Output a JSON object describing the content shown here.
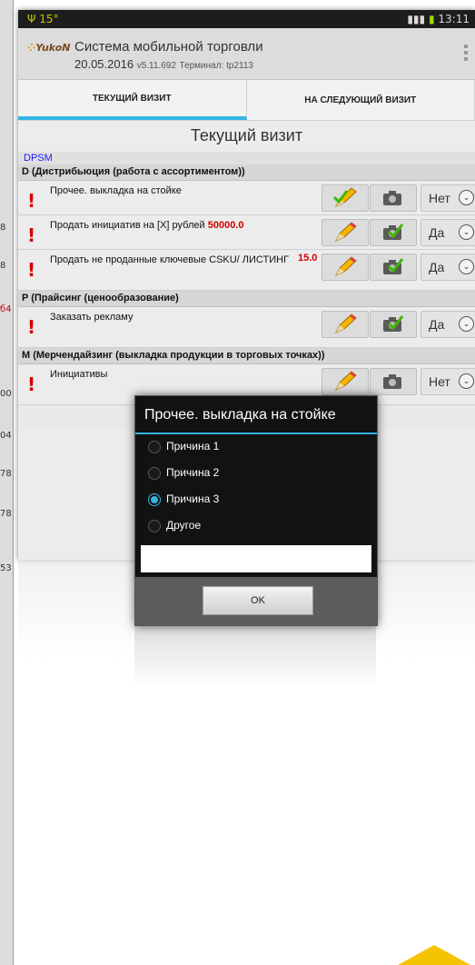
{
  "left_edge": {
    "numbers": [
      {
        "text": "8",
        "color": "#333333"
      },
      {
        "text": "8",
        "color": "#333333"
      },
      {
        "text": "б4",
        "color": "#d00000"
      },
      {
        "text": "00",
        "color": "#333333"
      },
      {
        "text": "04",
        "color": "#333333"
      },
      {
        "text": "78",
        "color": "#333333"
      },
      {
        "text": "78",
        "color": "#333333"
      },
      {
        "text": "53",
        "color": "#333333"
      }
    ]
  },
  "status_bar": {
    "left_text": "Ψ 15°",
    "time": "13:11"
  },
  "app": {
    "logo_text": "YukoN",
    "title": "Система мобильной торговли",
    "date": "20.05.2016",
    "version": "v5.11.692",
    "terminal": "Терминал: tp2113"
  },
  "tabs": [
    {
      "label": "ТЕКУЩИЙ ВИЗИТ",
      "active": true
    },
    {
      "label": "НА СЛЕДУЮЩИЙ ВИЗИТ",
      "active": false
    }
  ],
  "screen_title": "Текущий визит",
  "group_label": "DPSM",
  "sections": [
    {
      "title": "D (Дистрибьюция (работа с ассортиментом))",
      "rows": [
        {
          "label": "Прочее. выкладка на стойке",
          "value": "",
          "answer": "Нет",
          "tall": false
        },
        {
          "label": "Продать инициатив на [X] рублей",
          "value": "50000.0",
          "answer": "Да",
          "tall": false
        },
        {
          "label": "Продать не проданные ключевые CSKU/ ЛИСТИНГ",
          "value": "15.0",
          "answer": "Да",
          "tall": true
        }
      ]
    },
    {
      "title": "P (Прайсинг (ценообразование)",
      "rows": [
        {
          "label": "Заказать рекламу",
          "value": "",
          "answer": "Да",
          "tall": true
        }
      ]
    },
    {
      "title": "M (Мерчендайзинг (выкладка продукции в торговых точках))",
      "rows": [
        {
          "label": "Инициативы",
          "value": "",
          "answer": "Нет",
          "tall": true
        }
      ]
    }
  ],
  "dialog": {
    "title": "Прочее. выкладка на стойке",
    "options": [
      {
        "label": "Причина 1",
        "selected": false
      },
      {
        "label": "Причина 2",
        "selected": false
      },
      {
        "label": "Причина 3",
        "selected": true
      },
      {
        "label": "Другое",
        "selected": false
      }
    ],
    "input_value": "",
    "ok_label": "OK"
  },
  "colors": {
    "accent": "#33b5e5",
    "alert_red": "#d40000",
    "dpsm_blue": "#1a1aff",
    "corner_yellow": "#f5c400"
  },
  "icons": [
    "pencil-icon",
    "camera-icon",
    "chevron-down-icon",
    "exclamation-icon",
    "signal-icon",
    "wifi-icon",
    "battery-icon",
    "overflow-menu-icon"
  ]
}
